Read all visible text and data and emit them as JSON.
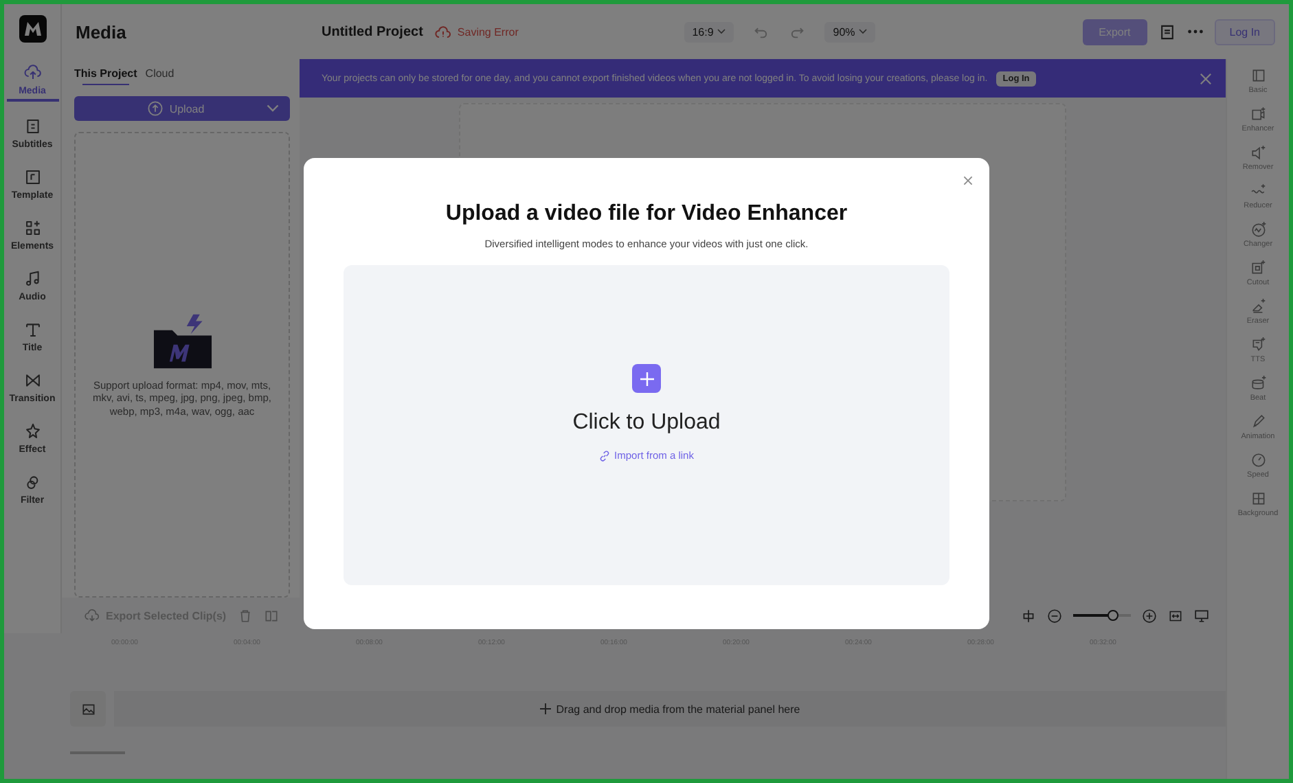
{
  "nav": [
    {
      "label": "Media",
      "selected": true
    },
    {
      "label": "Subtitles",
      "selected": false
    },
    {
      "label": "Template",
      "selected": false
    },
    {
      "label": "Elements",
      "selected": false
    },
    {
      "label": "Audio",
      "selected": false
    },
    {
      "label": "Title",
      "selected": false
    },
    {
      "label": "Transition",
      "selected": false
    },
    {
      "label": "Effect",
      "selected": false
    },
    {
      "label": "Filter",
      "selected": false
    }
  ],
  "panel": {
    "title": "Media",
    "tabs": [
      {
        "label": "This Project",
        "selected": true
      },
      {
        "label": "Cloud",
        "selected": false
      }
    ],
    "upload_button": "Upload",
    "formats": "Support upload format: mp4, mov, mts, mkv, avi, ts, mpeg, jpg, png, jpeg, bmp, webp, mp3, m4a, wav, ogg, aac"
  },
  "topbar": {
    "project_title": "Untitled Project",
    "save_status": "Saving Error",
    "aspect_ratio": "16:9",
    "zoom": "90%",
    "export_button": "Export",
    "login_button": "Log In"
  },
  "banner": {
    "text": "Your projects can only be stored for one day, and you cannot export finished videos when you are not logged in. To avoid losing your creations, please log in.",
    "login_button": "Log In"
  },
  "toolbar": {
    "export_clips": "Export Selected Clip(s)",
    "zoom_slider": {
      "level": 0.7
    }
  },
  "timeline": {
    "ticks": [
      "00:00:00",
      "00:04:00",
      "00:08:00",
      "00:12:00",
      "00:16:00",
      "00:20:00",
      "00:24:00",
      "00:28:00",
      "00:32:00"
    ],
    "drop_hint": "Drag and drop media from the material panel here"
  },
  "tools": [
    {
      "label": "Basic"
    },
    {
      "label": "Enhancer"
    },
    {
      "label": "Remover"
    },
    {
      "label": "Reducer"
    },
    {
      "label": "Changer"
    },
    {
      "label": "Cutout"
    },
    {
      "label": "Eraser"
    },
    {
      "label": "TTS"
    },
    {
      "label": "Beat"
    },
    {
      "label": "Animation"
    },
    {
      "label": "Speed"
    },
    {
      "label": "Background"
    }
  ],
  "modal": {
    "title": "Upload a video file for Video Enhancer",
    "subtitle": "Diversified intelligent modes to enhance your videos with just one click.",
    "upload_label": "Click to Upload",
    "link_label": "Import from a link"
  }
}
